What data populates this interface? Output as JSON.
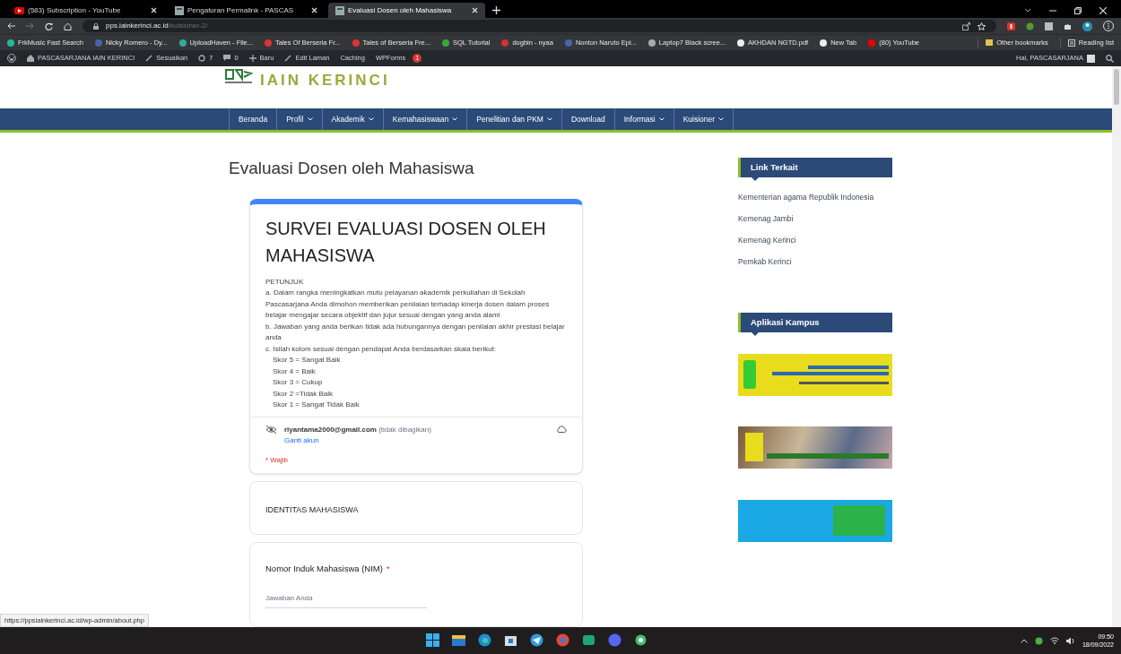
{
  "browser": {
    "tabs": [
      {
        "title": "(583) Subscription - YouTube",
        "kind": "video",
        "selected": false
      },
      {
        "title": "Pengaturan Permalink - PASCAS",
        "kind": "page",
        "selected": false
      },
      {
        "title": "Evaluasi Dosen oleh Mahasiswa",
        "kind": "page",
        "selected": true
      }
    ],
    "address_host": "pps.iainkerinci.ac.id",
    "address_path": "/kuisioner-2/",
    "bookmarks": [
      "FrkMusic Fast Search",
      "Nicky Romero - Dy...",
      "UploadHaven - File...",
      "Tales Of Berseria Fr...",
      "Tales of Berseria Fre...",
      "SQL Tutorial",
      "dogbin - nyaa",
      "Nonton Naruto Epi...",
      "Laptop7 Black scree...",
      "AKHDAN NGTD.pdf",
      "New Tab",
      "(80) YouTube"
    ],
    "other_bookmarks": "Other bookmarks",
    "reading_list": "Reading list"
  },
  "admin_bar": {
    "site": "PASCASARJANA IAIN KERINCI",
    "customize": "Sesuaikan",
    "updates": "7",
    "comments": "0",
    "new": "Baru",
    "edit": "Edit Laman",
    "caching": "Caching",
    "wpforms": "WPForms",
    "wpforms_badge": "1",
    "greeting": "Hai, PASCASARJANA"
  },
  "site": {
    "logo_text": "IAIN KERINCI",
    "nav": [
      {
        "label": "Beranda",
        "dropdown": false
      },
      {
        "label": "Profil",
        "dropdown": true
      },
      {
        "label": "Akademik",
        "dropdown": true
      },
      {
        "label": "Kemahasiswaan",
        "dropdown": true
      },
      {
        "label": "Penelitian dan PKM",
        "dropdown": true
      },
      {
        "label": "Download",
        "dropdown": false
      },
      {
        "label": "Informasi",
        "dropdown": true
      },
      {
        "label": "Kuisioner",
        "dropdown": true
      }
    ],
    "page_title": "Evaluasi Dosen oleh Mahasiswa",
    "form": {
      "title": "SURVEI EVALUASI DOSEN OLEH MAHASISWA",
      "instructions_heading": "PETUNJUK",
      "instructions": [
        "a. Dalam rangka meningkatkan mutu pelayanan akademik perkuliahan di Sekolah Pascasarjana Anda dimohon memberikan penilaian terhadap kinerja dosen dalam proses belajar mengajar secara objektif dan jujur sesuai dengan yang anda alami",
        "b. Jawaban yang anda berikan tidak ada hubungannya dengan penilaian akhir prestasi belajar anda",
        "c. Isilah kolom sesuai dengan pendapat Anda berdasarkan skala berikut:"
      ],
      "scores": [
        "Skor 5 = Sangat Baik",
        "Skor 4 = Baik",
        "Skor 3 = Cukup",
        "Skor 2 =Tidak Baik",
        "Skor 1 = Sangat Tidak Baik"
      ],
      "email": "riyantama2000@gmail.com",
      "email_note": "(tidak dibagikan)",
      "switch_account": "Ganti akun",
      "required_note": "* Wajib",
      "section": "IDENTITAS MAHASISWA",
      "question": "Nomor Induk Mahasiswa (NIM)",
      "question_required_mark": "*",
      "answer_placeholder": "Jawaban Anda"
    },
    "sidebar": {
      "links_heading": "Link Terkait",
      "links": [
        "Kementerian agama Republik Indonesia",
        "Kemenag Jambi",
        "Kemenag Kerinci",
        "Pemkab Kerinci"
      ],
      "apps_heading": "Aplikasi Kampus"
    }
  },
  "status_url": "https://ppsiainkerinci.ac.id/wp-admin/about.php",
  "taskbar": {
    "time": "09:50",
    "date": "18/09/2022"
  }
}
